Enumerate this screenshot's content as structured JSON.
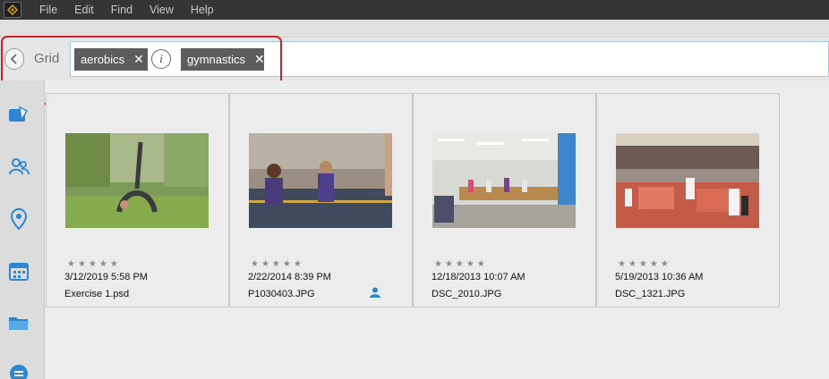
{
  "menu": {
    "items": [
      "File",
      "Edit",
      "Find",
      "View",
      "Help"
    ]
  },
  "search": {
    "view_label": "Grid",
    "tags": [
      {
        "label": "aerobics"
      },
      {
        "label": "gymnastics"
      }
    ],
    "operator_glyph": "i"
  },
  "nav": {
    "icons": [
      "media-icon",
      "people-icon",
      "places-icon",
      "events-icon",
      "folders-icon",
      "more-icon"
    ]
  },
  "grid": {
    "items": [
      {
        "date": "3/12/2019 5:58 PM",
        "filename": "Exercise 1.psd",
        "rating": 0,
        "stars": "★★★★★",
        "has_people": false
      },
      {
        "date": "2/22/2014 8:39 PM",
        "filename": "P1030403.JPG",
        "rating": 0,
        "stars": "★★★★★",
        "has_people": true
      },
      {
        "date": "12/18/2013 10:07 AM",
        "filename": "DSC_2010.JPG",
        "rating": 0,
        "stars": "★★★★★",
        "has_people": false
      },
      {
        "date": "5/19/2013 10:36 AM",
        "filename": "DSC_1321.JPG",
        "rating": 0,
        "stars": "★★★★★",
        "has_people": false
      }
    ]
  },
  "colors": {
    "menubar": "#353535",
    "tag_bg": "#5d5d5d",
    "highlight": "#d21f2d",
    "nav_icon": "#2e86d0"
  }
}
